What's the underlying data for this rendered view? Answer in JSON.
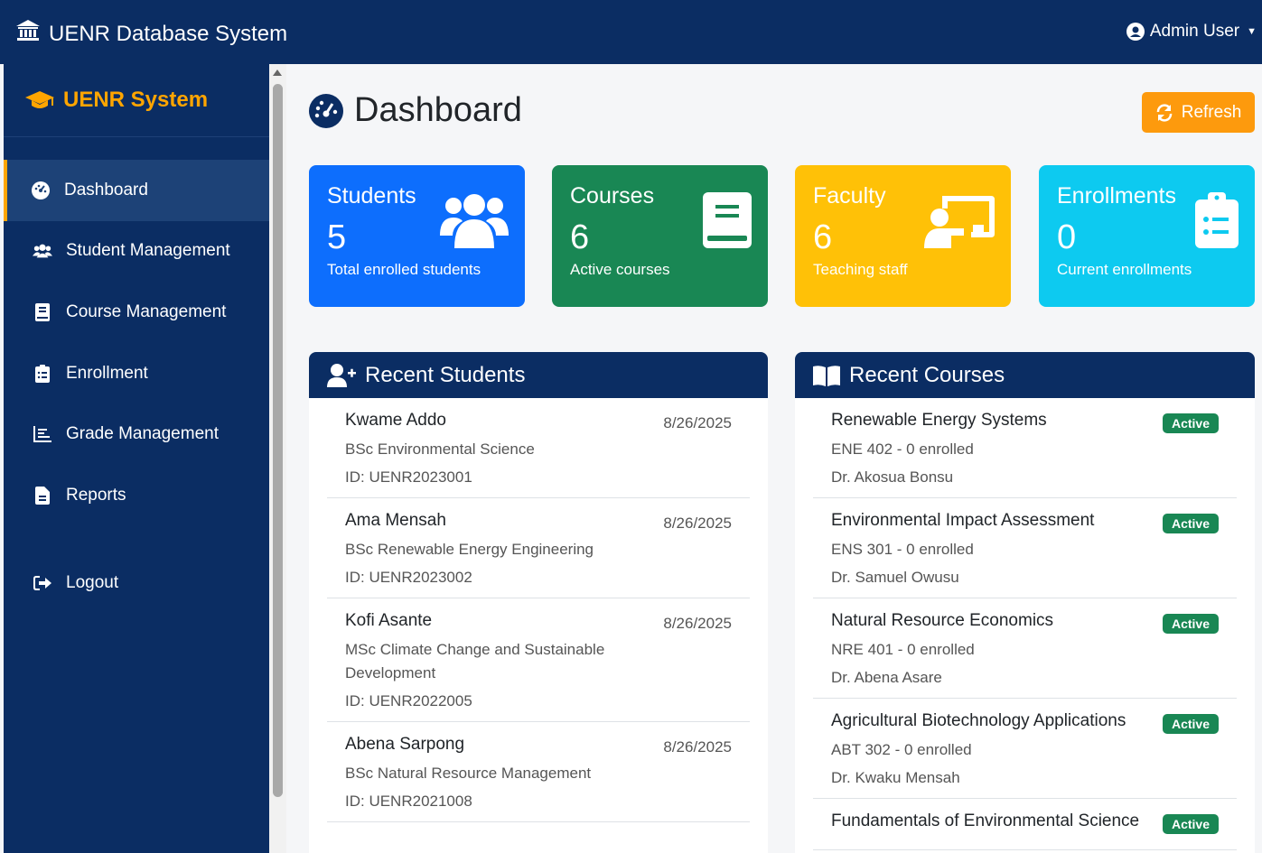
{
  "navbar": {
    "title": "UENR Database System",
    "user": "Admin User"
  },
  "sidebar": {
    "brand": "UENR System",
    "items": [
      {
        "label": "Dashboard",
        "icon": "gauge-icon"
      },
      {
        "label": "Student Management",
        "icon": "users-icon"
      },
      {
        "label": "Course Management",
        "icon": "book-icon"
      },
      {
        "label": "Enrollment",
        "icon": "clipboard-icon"
      },
      {
        "label": "Grade Management",
        "icon": "chart-icon"
      },
      {
        "label": "Reports",
        "icon": "file-icon"
      }
    ],
    "logout": "Logout"
  },
  "page": {
    "title": "Dashboard",
    "refresh": "Refresh"
  },
  "stats": [
    {
      "title": "Students",
      "value": "5",
      "subtitle": "Total enrolled students",
      "color": "#0d6efd"
    },
    {
      "title": "Courses",
      "value": "6",
      "subtitle": "Active courses",
      "color": "#198754"
    },
    {
      "title": "Faculty",
      "value": "6",
      "subtitle": "Teaching staff",
      "color": "#ffc107"
    },
    {
      "title": "Enrollments",
      "value": "0",
      "subtitle": "Current enrollments",
      "color": "#0dcaf0"
    }
  ],
  "recent_students": {
    "title": "Recent Students",
    "items": [
      {
        "name": "Kwame Addo",
        "date": "8/26/2025",
        "program": "BSc Environmental Science",
        "id": "ID: UENR2023001"
      },
      {
        "name": "Ama Mensah",
        "date": "8/26/2025",
        "program": "BSc Renewable Energy Engineering",
        "id": "ID: UENR2023002"
      },
      {
        "name": "Kofi Asante",
        "date": "8/26/2025",
        "program": "MSc Climate Change and Sustainable Development",
        "id": "ID: UENR2022005"
      },
      {
        "name": "Abena Sarpong",
        "date": "8/26/2025",
        "program": "BSc Natural Resource Management",
        "id": "ID: UENR2021008"
      }
    ]
  },
  "recent_courses": {
    "title": "Recent Courses",
    "items": [
      {
        "name": "Renewable Energy Systems",
        "status": "Active",
        "info": "ENE 402 - 0 enrolled",
        "lecturer": "Dr. Akosua Bonsu"
      },
      {
        "name": "Environmental Impact Assessment",
        "status": "Active",
        "info": "ENS 301 - 0 enrolled",
        "lecturer": "Dr. Samuel Owusu"
      },
      {
        "name": "Natural Resource Economics",
        "status": "Active",
        "info": "NRE 401 - 0 enrolled",
        "lecturer": "Dr. Abena Asare"
      },
      {
        "name": "Agricultural Biotechnology Applications",
        "status": "Active",
        "info": "ABT 302 - 0 enrolled",
        "lecturer": "Dr. Kwaku Mensah"
      },
      {
        "name": "Fundamentals of Environmental Science",
        "status": "Active",
        "info": "",
        "lecturer": ""
      }
    ]
  }
}
